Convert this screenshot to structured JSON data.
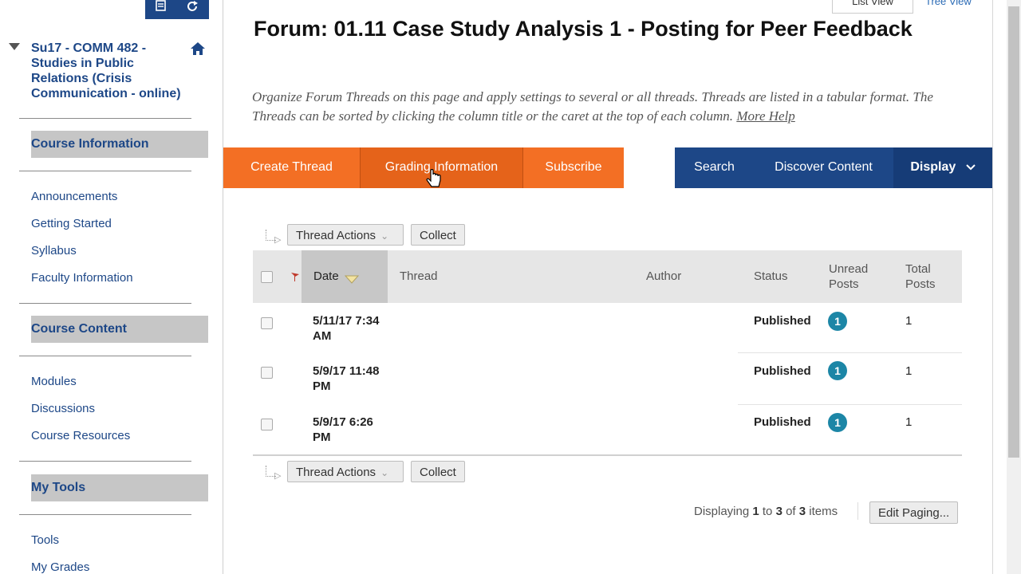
{
  "sidebar": {
    "course_title": "Su17 - COMM 482 - Studies in Public Relations (Crisis Communication - online)",
    "sections": [
      {
        "heading": "Course Information",
        "links": [
          "Announcements",
          "Getting Started",
          "Syllabus",
          "Faculty Information"
        ]
      },
      {
        "heading": "Course Content",
        "links": [
          "Modules",
          "Discussions",
          "Course Resources"
        ]
      },
      {
        "heading": "My Tools",
        "links": [
          "Tools",
          "My Grades"
        ]
      }
    ]
  },
  "header": {
    "list_view_tab": "List View",
    "tree_view_tab": "Tree View",
    "title": "Forum: 01.11 Case Study Analysis 1 - Posting for Peer Feedback",
    "description": "Organize Forum Threads on this page and apply settings to several or all threads. Threads are listed in a tabular format. The Threads can be sorted by clicking the column title or the caret at the top of each column.",
    "more_help": "More Help"
  },
  "actionbar": {
    "create_thread": "Create Thread",
    "grading_information": "Grading Information",
    "subscribe": "Subscribe",
    "search": "Search",
    "discover_content": "Discover Content",
    "display": "Display"
  },
  "toolbar": {
    "thread_actions": "Thread Actions",
    "collect": "Collect"
  },
  "table": {
    "headers": {
      "date": "Date",
      "thread": "Thread",
      "author": "Author",
      "status": "Status",
      "unread_posts": "Unread Posts",
      "total_posts": "Total Posts"
    },
    "rows": [
      {
        "date": "5/11/17 7:34 AM",
        "thread": "",
        "author": "",
        "status": "Published",
        "unread": "1",
        "total": "1"
      },
      {
        "date": "5/9/17 11:48 PM",
        "thread": "",
        "author": "",
        "status": "Published",
        "unread": "1",
        "total": "1"
      },
      {
        "date": "5/9/17 6:26 PM",
        "thread": "",
        "author": "",
        "status": "Published",
        "unread": "1",
        "total": "1"
      }
    ]
  },
  "paging": {
    "prefix": "Displaying",
    "from": "1",
    "to_word": "to",
    "to": "3",
    "of_word": "of",
    "total": "3",
    "items_word": "items",
    "edit_paging": "Edit Paging..."
  },
  "colors": {
    "orange": "#f36f24",
    "navy": "#1d4787",
    "badge": "#1c86a6"
  }
}
